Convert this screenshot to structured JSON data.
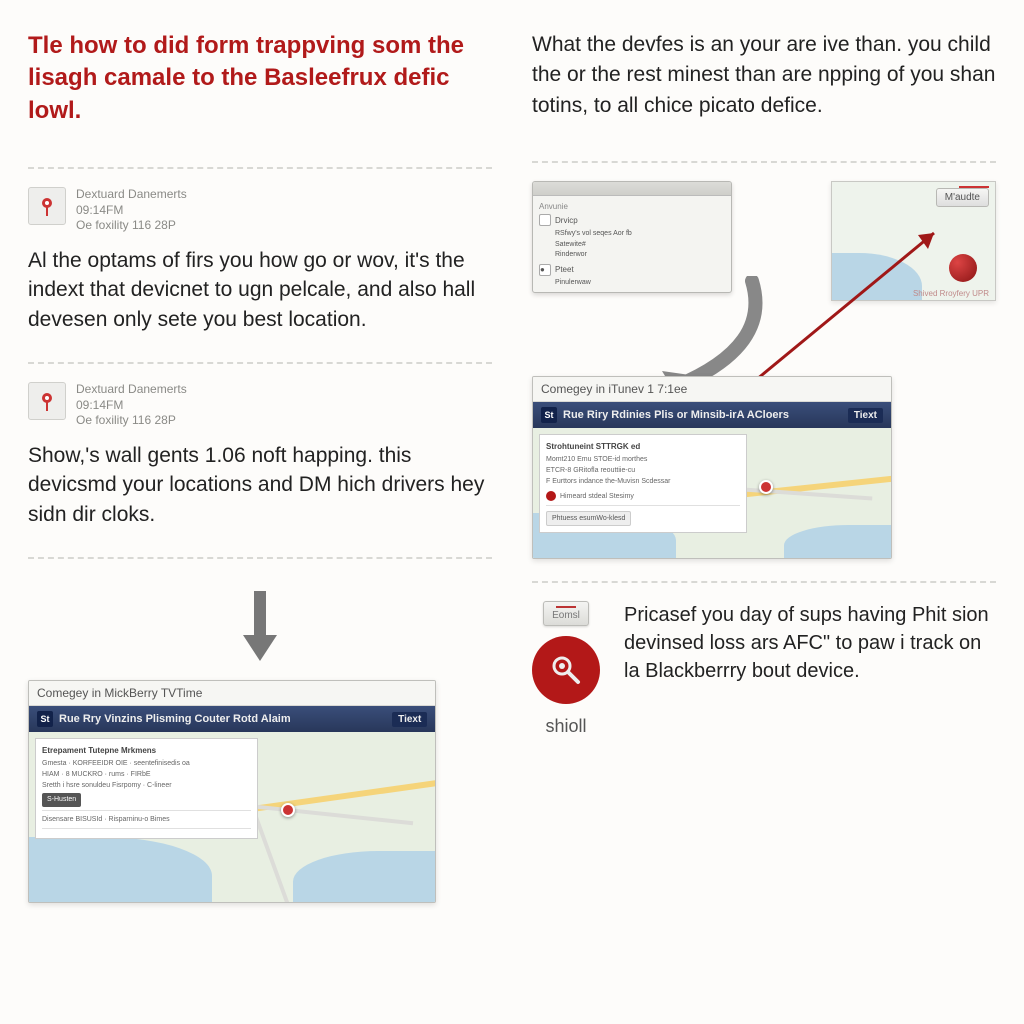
{
  "left": {
    "headline": "Tle how to did form trappving som the lisagh camale to the Basleefrux defic lowl.",
    "block1": {
      "meta_line1": "Dextuard Danemerts",
      "meta_line2": "09:14FM",
      "meta_line3": "Oe foxility 116 28P",
      "body": "Al the optams of firs you how go or wov, it's the indext that devicnet to ugn pelcale, and also hall devesen only sete you best location."
    },
    "block2": {
      "meta_line1": "Dextuard Danemerts",
      "meta_line2": "09:14FM",
      "meta_line3": "Oe foxility 116 28P",
      "body": "Show,'s wall gents 1.06 noft happing. this devicsmd your locations and DM hich drivers hey sidn dir cloks."
    },
    "map": {
      "title": "Comegey in MickBerry TVTime",
      "bar_text": "Rue Rry Vinzins Plisming Couter Rotd Alaim",
      "bar_btn": "Tiext",
      "overlay_title": "Etrepament Tutepne Mrkmens",
      "overlay_lines": "Gmesta · KORFEEIDR OIE · seentefinisedis oa\nHIAM · 8 MUCKRO · rums · FIRbE\nSretth i hsre sonuldeu Fisrpomy · C-lineer",
      "overlay_btn": "S-Husten",
      "overlay_key": "Disensare BISUSId · Risparninu-o Bimes"
    }
  },
  "right": {
    "intro": "What the devfes is an your are ive than. you child the or the rest minest than are npping of you shan totins, to all chice picato defice.",
    "settings_window": {
      "title": "Anvunie",
      "row1": "Drvicp",
      "row2": "RSfwy's vol seqes Aor fb",
      "row3": "Satewite#",
      "row4": "Rinderwor",
      "row5": "Pteet",
      "row6": "Pinulerwaw"
    },
    "mini_btn": "M'audte",
    "mini_caption": "Shived Rroyfery UPR",
    "map": {
      "title": "Comegey in iTunev 1 7:1ee",
      "bar_text": "Rue Riry Rdinies Plis or Minsib-irA ACloers",
      "bar_btn": "Tiext",
      "overlay_title": "Strohtuneint STTRGK ed",
      "overlay_lines": "Momt210 Emu STOE-id morthes\nETCR-8 GRitofla reouttiie-cu\nF Eurttors indance the-Muvisn Scdessar",
      "overlay_key": "Himeard stdeal Stesimy",
      "overlay_btn": "Phtuess esumWo-klesd"
    },
    "promo": {
      "btn": "Eomsl",
      "label": "shioll",
      "text": "Pricasef you day of sups having Phit sion devinsed loss ars AFC\" to paw i track on la Blackberrry bout device."
    }
  }
}
